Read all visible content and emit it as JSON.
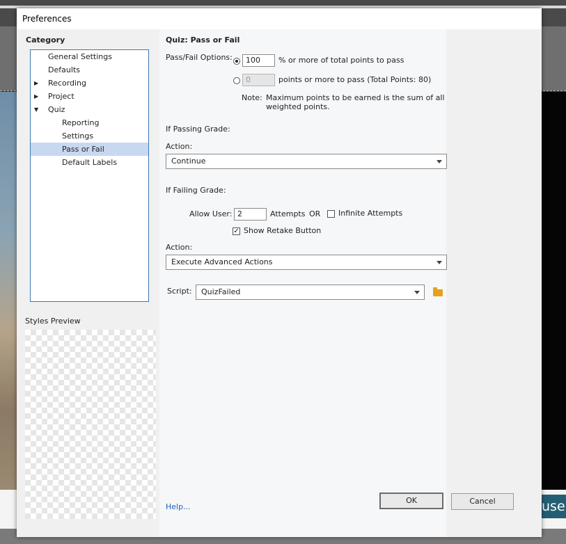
{
  "background": {
    "side_button_label": "use"
  },
  "dialog": {
    "title": "Preferences",
    "category_label": "Category",
    "tree": [
      {
        "label": "General Settings",
        "level": 0,
        "expander": ""
      },
      {
        "label": "Defaults",
        "level": 0,
        "expander": ""
      },
      {
        "label": "Recording",
        "level": 0,
        "expander": "collapsed"
      },
      {
        "label": "Project",
        "level": 0,
        "expander": "collapsed"
      },
      {
        "label": "Quiz",
        "level": 0,
        "expander": "expanded"
      },
      {
        "label": "Reporting",
        "level": 1,
        "expander": ""
      },
      {
        "label": "Settings",
        "level": 1,
        "expander": ""
      },
      {
        "label": "Pass or Fail",
        "level": 1,
        "expander": "",
        "selected": true
      },
      {
        "label": "Default Labels",
        "level": 1,
        "expander": ""
      }
    ],
    "styles_preview_label": "Styles Preview",
    "section_title": "Quiz: Pass or Fail",
    "pass_fail": {
      "options_label": "Pass/Fail Options:",
      "percent_value": "100",
      "percent_suffix": "% or more of total points to pass",
      "points_value": "0",
      "points_suffix": "points or more to pass (Total Points: 80)",
      "selected_option": "percent",
      "note_label": "Note:",
      "note_text_line1": "Maximum points to be earned is the sum of all",
      "note_text_line2": "weighted points."
    },
    "passing": {
      "heading": "If Passing Grade:",
      "action_label": "Action:",
      "action_value": "Continue"
    },
    "failing": {
      "heading": "If Failing Grade:",
      "allow_user_label": "Allow User:",
      "attempts_value": "2",
      "attempts_label": "Attempts",
      "or_label": "OR",
      "infinite_attempts_label": "Infinite Attempts",
      "infinite_attempts_checked": false,
      "show_retake_label": "Show Retake Button",
      "show_retake_checked": true,
      "action_label": "Action:",
      "action_value": "Execute Advanced Actions",
      "script_label": "Script:",
      "script_value": "QuizFailed"
    },
    "help_label": "Help...",
    "ok_label": "OK",
    "cancel_label": "Cancel",
    "colors": {
      "selection": "#c8d8f0",
      "tree_border": "#3b79b5",
      "link": "#1f62b8",
      "folder": "#e3a21a"
    }
  }
}
